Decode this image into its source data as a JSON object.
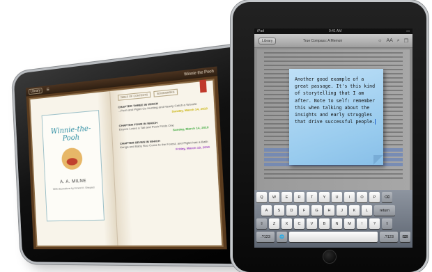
{
  "left_ipad": {
    "toolbar": {
      "library_button": "Library",
      "book_title": "Winnie the Pooh"
    },
    "tabs": [
      "TABLE OF CONTENTS",
      "BOOKMARKS"
    ],
    "cover": {
      "title": "Winnie-the-Pooh",
      "author": "A. A. MILNE",
      "subtitle": "With decorations by Ernest H. Shepard"
    },
    "toc": [
      {
        "heading": "CHAPTER THREE IN WHICH",
        "text": "...Pooh and Piglet Go Hunting and Nearly Catch a Woozle",
        "note": "Sunday, March 14, 2010",
        "color": "#c7b000"
      },
      {
        "heading": "CHAPTER FOUR IN WHICH",
        "text": "Eeyore Loses a Tail and Pooh Finds One",
        "note": "Sunday, March 14, 2010",
        "color": "#3aa83a"
      },
      {
        "heading": "CHAPTER SEVEN IN WHICH",
        "text": "Kanga and Baby Roo Come to the Forest, and Piglet has a Bath",
        "note": "Friday, March 19, 2010",
        "color": "#9b3ec2"
      }
    ]
  },
  "right_ipad": {
    "status": {
      "carrier": "iPad",
      "time": "9:41 AM"
    },
    "toolbar": {
      "library_button": "Library",
      "book_title": "True Compass: A Memoir",
      "font_label": "AA"
    },
    "note_text": "Another good example of a great passage. It's this kind of storytelling that I am after. Note to self: remember this when talking about the insights and early struggles that drive successful people.",
    "keyboard": {
      "row1": [
        "Q",
        "W",
        "E",
        "R",
        "T",
        "Y",
        "U",
        "I",
        "O",
        "P",
        "⌫"
      ],
      "row2": [
        "A",
        "S",
        "D",
        "F",
        "G",
        "H",
        "J",
        "K",
        "L",
        "return"
      ],
      "row3": [
        "⇧",
        "Z",
        "X",
        "C",
        "V",
        "B",
        "N",
        "M",
        "!",
        "?",
        "⇧"
      ],
      "row4": [
        ".?123",
        "🌐",
        "",
        ".?123",
        "⌨"
      ]
    }
  },
  "colors": {
    "note_blue": "#9fd0f0",
    "keyboard_gray": "#6e7580",
    "frame_black": "#0a0a0a"
  }
}
